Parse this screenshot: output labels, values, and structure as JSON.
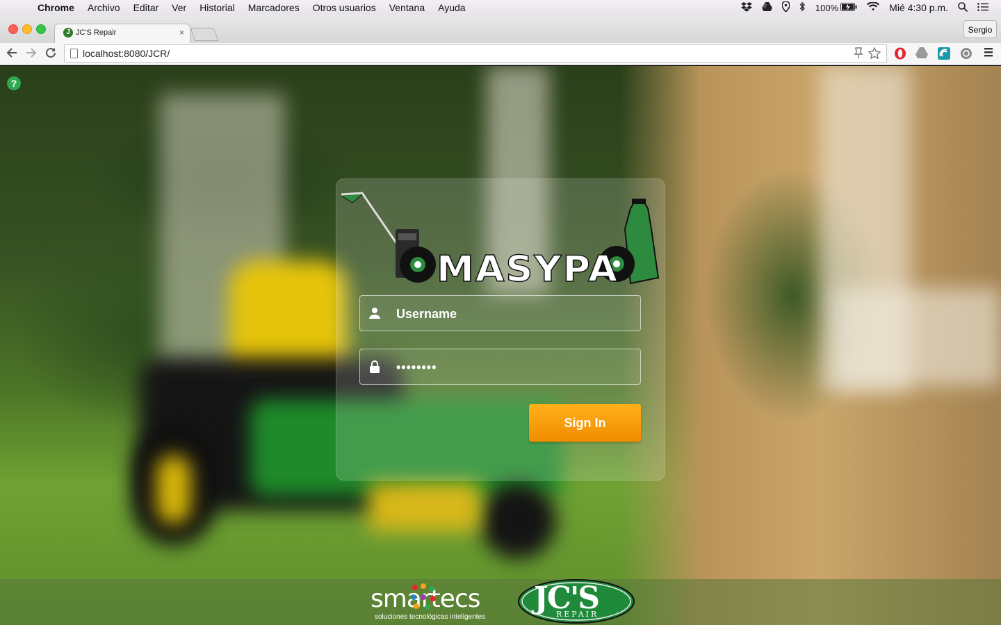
{
  "menubar": {
    "app": "Chrome",
    "items": [
      "Archivo",
      "Editar",
      "Ver",
      "Historial",
      "Marcadores",
      "Otros usuarios",
      "Ventana",
      "Ayuda"
    ],
    "battery": "100%",
    "clock": "Mié 4:30 p.m."
  },
  "browser": {
    "tab_title": "JC'S Repair",
    "tab_favicon_letter": "J",
    "tab_close": "×",
    "profile_name": "Sergio",
    "url": "localhost:8080/JCR/"
  },
  "page": {
    "help_label": "?",
    "logo_text": "MASYPA",
    "username_placeholder": "Username",
    "password_value": "••••••••",
    "signin_label": "Sign In",
    "colors": {
      "accent": "#f5a10a",
      "brand_green": "#2d8a3e",
      "help_green": "#2fa84f"
    }
  },
  "footer": {
    "partner_logo": "smartecs",
    "partner_tagline": "soluciones tecnológicas inteligentes",
    "brand_logo": "JC'S",
    "brand_sub": "REPAIR"
  }
}
